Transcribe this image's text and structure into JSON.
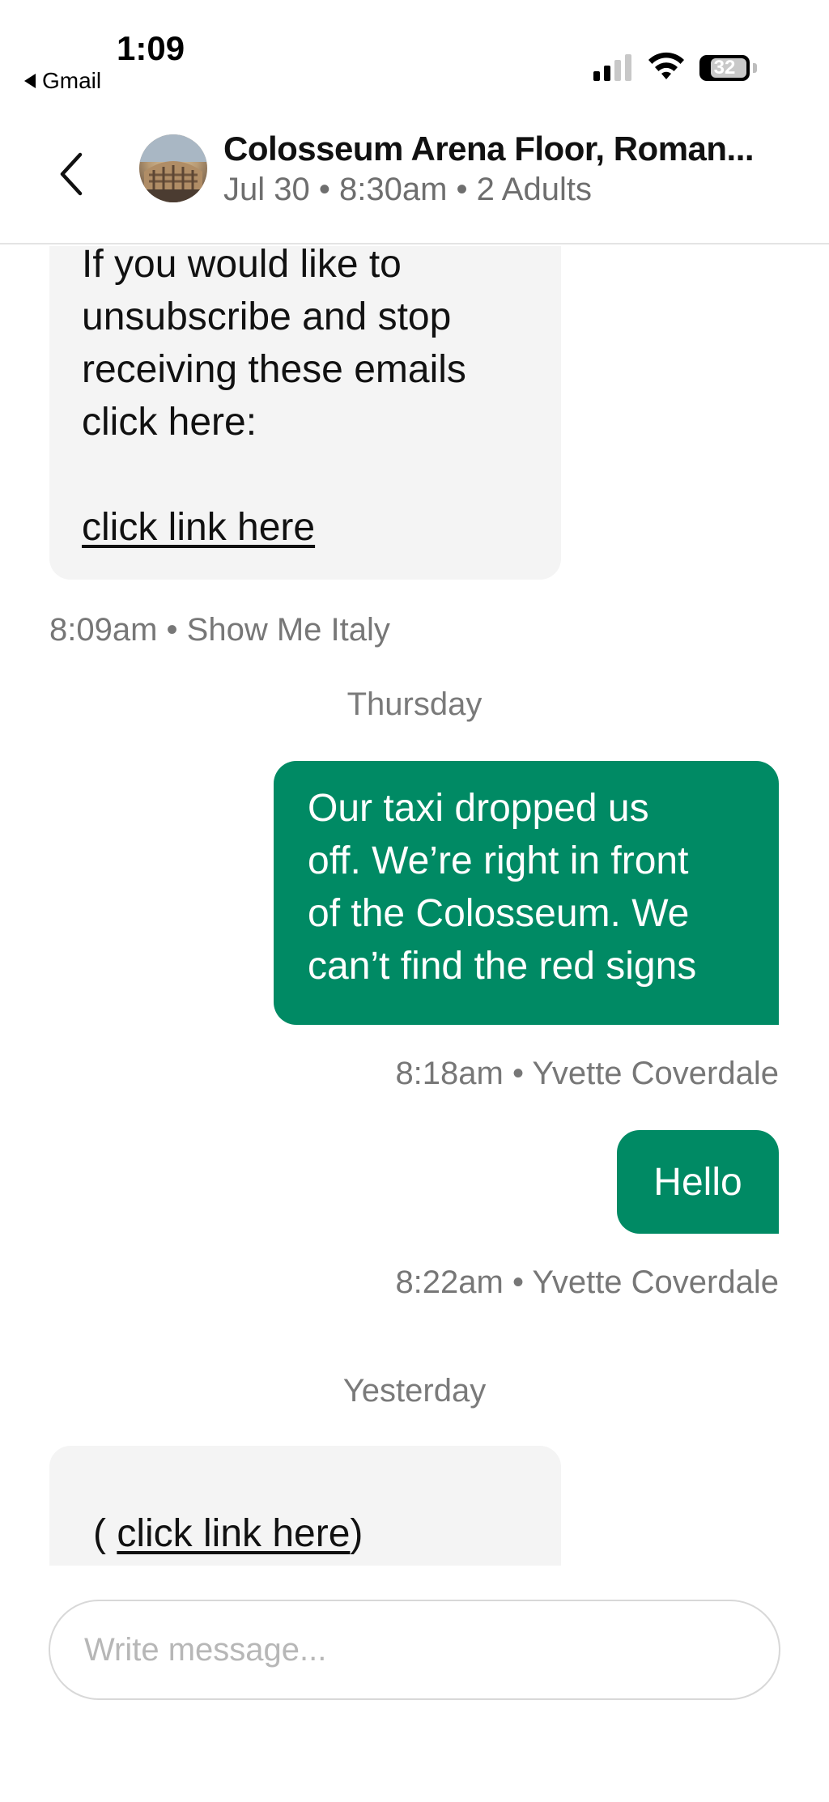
{
  "status_bar": {
    "time": "1:09",
    "back_app": "Gmail",
    "battery": "32"
  },
  "header": {
    "title": "Colosseum Arena Floor, Roman...",
    "subtitle": "Jul 30 • 8:30am • 2 Adults",
    "back_icon": "chevron-left-icon"
  },
  "messages": [
    {
      "direction": "incoming",
      "lines": [
        "If you would like to",
        "unsubscribe and stop",
        "receiving these emails",
        "click here:"
      ],
      "link": "click link here",
      "meta": "8:09am • Show Me Italy"
    },
    {
      "divider": "Thursday"
    },
    {
      "direction": "outgoing",
      "lines": [
        "Our taxi dropped us",
        "off. We’re right in front",
        "of the Colosseum. We",
        "can’t find the red signs"
      ],
      "meta": "8:18am • Yvette Coverdale"
    },
    {
      "direction": "outgoing",
      "text": "Hello",
      "meta": "8:22am • Yvette Coverdale"
    },
    {
      "divider": "Yesterday"
    },
    {
      "direction": "incoming",
      "prefix": "( ",
      "link": "click link here",
      "suffix": ")"
    }
  ],
  "composer": {
    "placeholder": "Write message..."
  },
  "colors": {
    "outgoing_bubble": "#008a64",
    "incoming_bubble": "#f4f4f4",
    "meta_text": "#777777"
  }
}
